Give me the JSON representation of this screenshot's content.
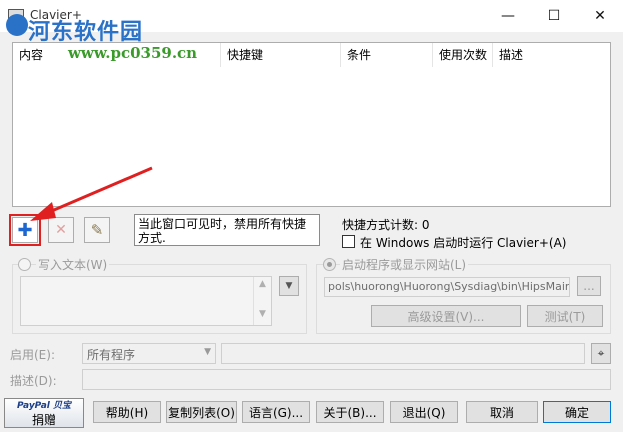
{
  "window": {
    "title": "Clavier+",
    "minimize_glyph": "—",
    "maximize_glyph": "☐",
    "close_glyph": "✕"
  },
  "watermark": {
    "line1": "河东软件园",
    "line2": "www.pc0359.cn"
  },
  "list": {
    "columns": [
      "内容",
      "快捷键",
      "条件",
      "使用次数",
      "描述"
    ]
  },
  "toolbar": {
    "add_glyph": "✚",
    "delete_glyph": "✕",
    "edit_glyph": "✎"
  },
  "info": {
    "disable_text": "当此窗口可见时，禁用所有快捷方式.",
    "count_label": "快捷方式计数:  0",
    "startup_label": "在 Windows 启动时运行 Clavier+(A)"
  },
  "write_text": {
    "label": "写入文本(W)"
  },
  "launch": {
    "label": "启动程序或显示网站(L)",
    "path": "pols\\huorong\\Huorong\\Sysdiag\\bin\\HipsMain.exe\"",
    "browse_label": "...",
    "advanced_label": "高级设置(V)...",
    "test_label": "测试(T)"
  },
  "enable": {
    "label": "启用(E):",
    "value": "所有程序"
  },
  "description": {
    "label": "描述(D):"
  },
  "buttons": {
    "paypal_brand": "PayPal 贝宝",
    "paypal_label": "捐赠",
    "help": "帮助(H)",
    "copy_list": "复制列表(O)",
    "language": "语言(G)...",
    "about": "关于(B)...",
    "exit": "退出(Q)",
    "cancel": "取消",
    "ok": "确定"
  },
  "colors": {
    "accent_blue": "#1e66d0",
    "arrow_red": "#e02020",
    "highlight_border": "#e02020"
  }
}
